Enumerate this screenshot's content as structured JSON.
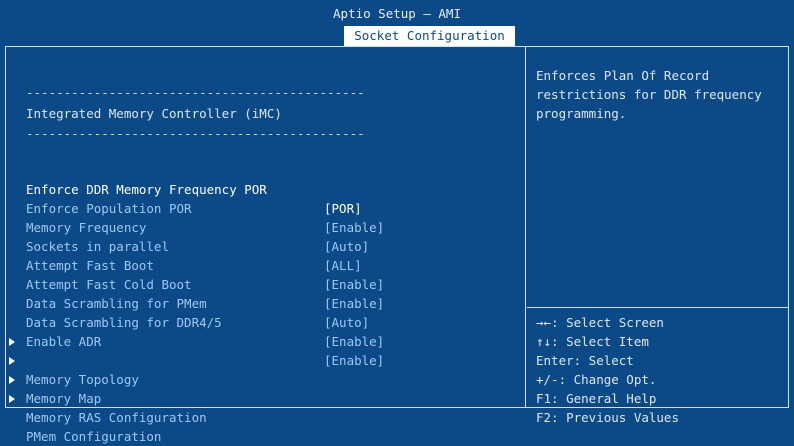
{
  "header": {
    "app_title": "Aptio Setup – AMI",
    "active_tab": "Socket Configuration"
  },
  "main": {
    "dash_line": "---------------------------------------------",
    "section_title": "Integrated Memory Controller (iMC)",
    "settings": [
      {
        "label": "Enforce DDR Memory Frequency POR",
        "value": "[POR]"
      },
      {
        "label": "Enforce Population POR",
        "value": "[Enable]"
      },
      {
        "label": "Memory Frequency",
        "value": "[Auto]"
      },
      {
        "label": "Sockets in parallel",
        "value": "[ALL]"
      },
      {
        "label": "Attempt Fast Boot",
        "value": "[Enable]"
      },
      {
        "label": "Attempt Fast Cold Boot",
        "value": "[Enable]"
      },
      {
        "label": "Data Scrambling for PMem",
        "value": "[Auto]"
      },
      {
        "label": "Data Scrambling for DDR4/5",
        "value": "[Enable]"
      },
      {
        "label": "Enable ADR",
        "value": "[Enable]"
      }
    ],
    "submenus": [
      {
        "label": "Memory Topology"
      },
      {
        "label": "Memory Map"
      },
      {
        "label": "Memory RAS Configuration"
      },
      {
        "label": "PMem Configuration"
      }
    ]
  },
  "help_panel": {
    "text": "Enforces Plan Of Record restrictions for DDR frequency programming."
  },
  "key_legend": [
    "→←: Select Screen",
    "↑↓: Select Item",
    "Enter: Select",
    "+/-: Change Opt.",
    "F1: General Help",
    "F2: Previous Values"
  ],
  "colors": {
    "background": "#0b4a86",
    "item_text": "#9fc7f0",
    "highlight_text": "#ffffff"
  }
}
